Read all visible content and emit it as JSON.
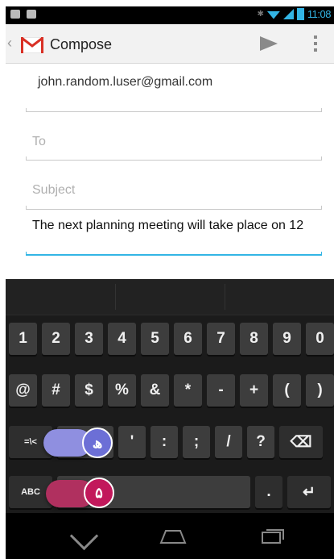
{
  "status_bar": {
    "time": "11:08"
  },
  "action_bar": {
    "title": "Compose"
  },
  "compose": {
    "from": "john.random.luser@gmail.com",
    "to_placeholder": "To",
    "subject_placeholder": "Subject",
    "body": "The next planning meeting will take place on 12"
  },
  "keyboard": {
    "row1": [
      "1",
      "2",
      "3",
      "4",
      "5",
      "6",
      "7",
      "8",
      "9",
      "0"
    ],
    "row2": [
      "@",
      "#",
      "$",
      "%",
      "&",
      "*",
      "-",
      "+",
      "(",
      ")"
    ],
    "row3": [
      "=\\<",
      "\"",
      "'",
      ":",
      ";",
      "/",
      "?",
      "⌫"
    ],
    "row4": {
      "abc": "ABC",
      "period": ".",
      "enter": "↵"
    }
  },
  "annotations": {
    "badge_1_label": "۵",
    "badge_1_color": "#c2185b",
    "badge_2_label": "ھ",
    "badge_2_color": "#6c6fd6"
  }
}
